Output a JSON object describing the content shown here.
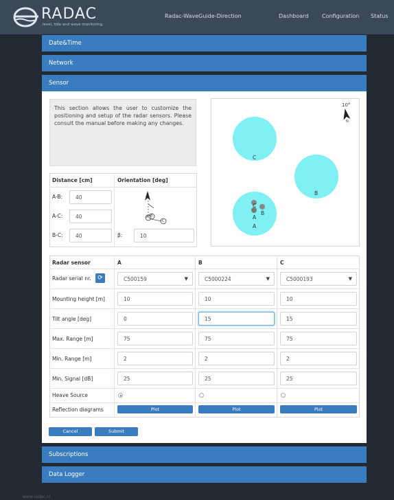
{
  "brand": {
    "name": "RADAC",
    "tagline": "level, tide and wave monitoring"
  },
  "app_title": "Radac-WaveGuide-Direction",
  "nav": {
    "dashboard": "Dashboard",
    "configuration": "Configuration",
    "status": "Status"
  },
  "sections": {
    "datetime": "Date&Time",
    "network": "Network",
    "sensor": "Sensor",
    "subscriptions": "Subscriptions",
    "data_logger": "Data Logger"
  },
  "sensor": {
    "intro": "This section allows the user to customize the positioning and setup of the radar sensors. Please consult the manual before making any changes.",
    "distance": {
      "header": "Distance [cm]",
      "ab_label": "A-B:",
      "ab_value": "40",
      "ac_label": "A-C:",
      "ac_value": "40",
      "bc_label": "B-C:",
      "bc_value": "40"
    },
    "orientation": {
      "header": "Orientation [deg]",
      "beta_label": "β:",
      "beta_value": "10"
    },
    "plot": {
      "angle_label": "10°",
      "north": "N",
      "radar_a": "A",
      "radar_b": "B",
      "radar_c": "C"
    },
    "table": {
      "headers": [
        "Radar sensor",
        "A",
        "B",
        "C"
      ],
      "rows": {
        "serial": "Radar serial nr.",
        "mounting": "Mounting height [m]",
        "tilt": "Tilt angle [deg]",
        "max_range": "Max. Range [m]",
        "min_range": "Min. Range [m]",
        "min_signal": "Min. Signal [dB]",
        "heave": "Heave Source",
        "reflection": "Reflection diagrams"
      },
      "a": {
        "serial": "C500159",
        "mounting": "10",
        "tilt": "0",
        "max_range": "75",
        "min_range": "2",
        "min_signal": "25",
        "heave_selected": true
      },
      "b": {
        "serial": "C5000224",
        "mounting": "10",
        "tilt": "15",
        "max_range": "75",
        "min_range": "2",
        "min_signal": "25",
        "heave_selected": false
      },
      "c": {
        "serial": "C5000193",
        "mounting": "10",
        "tilt": "15",
        "max_range": "75",
        "min_range": "2",
        "min_signal": "25",
        "heave_selected": false
      },
      "plot_label": "Plot"
    },
    "cancel": "Cancel",
    "submit": "Submit"
  },
  "footer": "www.radac.nl",
  "colors": {
    "navbar": "#3b4858",
    "section": "#3a7cc0",
    "background": "#232a32",
    "radar_circle": "#7ff0f3"
  }
}
